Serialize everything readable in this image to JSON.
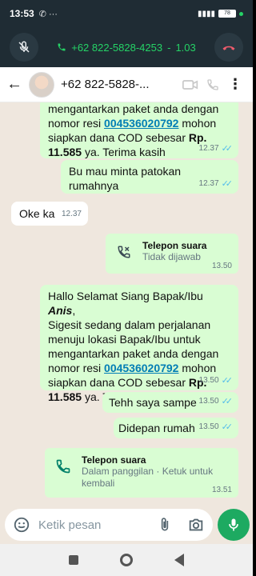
{
  "status": {
    "time": "13:53",
    "battery": "78"
  },
  "call": {
    "number": "+62 822-5828-4253",
    "duration": "1.03"
  },
  "header": {
    "contact": "+62 822-5828-..."
  },
  "messages": {
    "m1": {
      "line1": "mengantarkan paket anda dengan",
      "line2a": "nomor resi ",
      "resi": "004536020792",
      "line2b": " mohon",
      "line3a": "siapkan dana COD sebesar ",
      "amt1": "Rp.",
      "amt2": "11.585",
      "line4b": " ya. Terima kasih",
      "time": "12.37"
    },
    "m2": {
      "text": "Bu mau minta patokan rumahnya",
      "time": "12.37"
    },
    "m3": {
      "text": "Oke ka",
      "time": "12.37"
    },
    "call1": {
      "title": "Telepon suara",
      "sub": "Tidak dijawab",
      "time": "13.50"
    },
    "m4": {
      "l1a": "Hallo Selamat Siang Bapak/Ibu ",
      "name": "Anis",
      "l1b": ",",
      "l2": "Sigesit sedang dalam perjalanan",
      "l3": "menuju lokasi Bapak/Ibu untuk",
      "l4": "mengantarkan paket anda dengan",
      "l5a": "nomor resi ",
      "resi": "004536020792",
      "l5b": " mohon",
      "l6a": "siapkan dana COD sebesar ",
      "amt1": "Rp.",
      "amt2": "11.585",
      "l7b": " ya. Terima kasih",
      "time": "13.50"
    },
    "m5": {
      "text": "Tehh saya sampe",
      "time": "13.50"
    },
    "m6": {
      "text": "Didepan rumah",
      "time": "13.50"
    },
    "call2": {
      "title": "Telepon suara",
      "sub": "Dalam panggilan · Ketuk untuk kembali",
      "time": "13.51"
    }
  },
  "composer": {
    "placeholder": "Ketik pesan"
  },
  "colors": {
    "accent": "#25d366",
    "bubble_out": "#d9fdd3",
    "tick": "#53bdeb"
  }
}
